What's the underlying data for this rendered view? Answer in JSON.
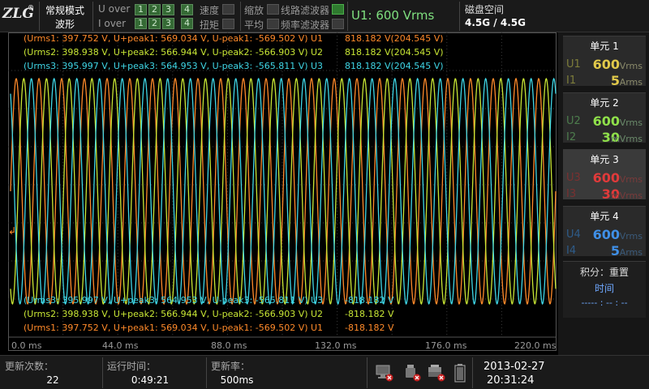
{
  "header": {
    "logo": "ZLG",
    "logo_mark": "®",
    "mode_line1": "常规模式",
    "mode_line2": "波形",
    "u_over_label": "U over",
    "i_over_label": "I over",
    "over_boxes": [
      "1",
      "2",
      "3",
      "4"
    ],
    "flags": {
      "speed": "速度",
      "torque": "扭矩",
      "zoom": "缩放",
      "average": "平均",
      "line_filter": "线路滤波器",
      "freq_filter": "频率滤波器"
    },
    "line_filter_on": true,
    "u1_range": "U1: 600 Vrms",
    "disk_label": "磁盘空间",
    "disk_value": "4.5G / 4.5G"
  },
  "scope": {
    "top_meas": [
      {
        "text": "(Urms1: 397.752 V, U+peak1: 569.034 V, U-peak1: -569.502 V) U1",
        "value": "818.182 V(204.545 V)",
        "color": "orange"
      },
      {
        "text": "(Urms2: 398.938 V, U+peak2: 566.944 V, U-peak2: -566.903 V) U2",
        "value": "818.182 V(204.545 V)",
        "color": "yellow"
      },
      {
        "text": "(Urms3: 395.997 V, U+peak3: 564.953 V, U-peak3: -565.811 V) U3",
        "value": "818.182 V(204.545 V)",
        "color": "cyan"
      }
    ],
    "bottom_meas": [
      {
        "text": "(Urms3: 395.997 V, U+peak3: 564.953 V, U-peak3: -565.811 V) U3",
        "value": "-818.182 V",
        "color": "cyan"
      },
      {
        "text": "(Urms2: 398.938 V, U+peak2: 566.944 V, U-peak2: -566.903 V) U2",
        "value": "-818.182 V",
        "color": "yellow"
      },
      {
        "text": "(Urms1: 397.752 V, U+peak1: 569.034 V, U-peak1: -569.502 V) U1",
        "value": "-818.182 V",
        "color": "orange"
      }
    ],
    "x_ticks": [
      "0.0 ms",
      "44.0 ms",
      "88.0 ms",
      "132.0 ms",
      "176.0 ms",
      "220.0 ms"
    ],
    "trigger_marker": "↲",
    "waveform": {
      "cycles": 24,
      "amplitude_v": 569,
      "full_scale_v": 818.182,
      "phase_deg": [
        0,
        -120,
        120
      ]
    },
    "colors": {
      "orange": "#ff8a2a",
      "yellow": "#c8e635",
      "cyan": "#3fd6e6"
    }
  },
  "units": [
    {
      "title": "单元 1",
      "r1_label": "U1",
      "r1_value": "600",
      "r1_unit": "Vrms",
      "r2_label": "I1",
      "r2_value": "5",
      "r2_unit": "Arms",
      "style": "ok"
    },
    {
      "title": "单元 2",
      "r1_label": "U2",
      "r1_value": "600",
      "r1_unit": "Vrms",
      "r2_label": "I2",
      "r2_value": "30",
      "r2_unit": "mVrms",
      "style": "ok2"
    },
    {
      "title": "单元 3",
      "r1_label": "U3",
      "r1_value": "600",
      "r1_unit": "Vrms",
      "r2_label": "I3",
      "r2_value": "30",
      "r2_unit": "mVrms",
      "style": "bad"
    },
    {
      "title": "单元 4",
      "r1_label": "U4",
      "r1_value": "600",
      "r1_unit": "Vrms",
      "r2_label": "I4",
      "r2_value": "5",
      "r2_unit": "Arms",
      "style": "blue"
    }
  ],
  "integration": {
    "title": "积分：重置",
    "time_label": "时间",
    "time_value": "----- : -- : --"
  },
  "status": {
    "update_count_label": "更新次数：",
    "update_count": "22",
    "run_time_label": "运行时间：",
    "run_time": "0:49:21",
    "update_rate_label": "更新率：",
    "update_rate": "500ms",
    "date": "2013-02-27",
    "time": "20:31:24"
  }
}
